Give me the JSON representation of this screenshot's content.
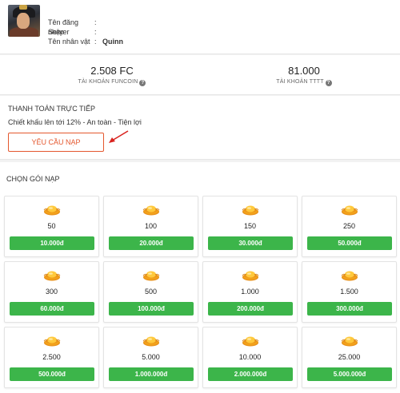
{
  "profile": {
    "login_label": "Tên đăng nhập",
    "login_sep": ":",
    "login_value": "",
    "server_label": "Server",
    "server_sep": ":",
    "server_value": "",
    "character_label": "Tên nhân vật",
    "character_sep": ":",
    "character_value": "Quinn"
  },
  "balances": {
    "funcoin_value": "2.508 FC",
    "funcoin_label": "TÀI KHOẢN FUNCOIN",
    "tttt_value": "81.000",
    "tttt_label": "TÀI KHOẢN TTTT",
    "help_glyph": "?"
  },
  "direct": {
    "title": "THANH TOÁN TRỰC TIẾP",
    "subtitle": "Chiết khấu lên tới 12% - An toàn - Tiện lợi",
    "button_label": "YÊU CẦU NẠP"
  },
  "packages": {
    "title": "CHỌN GÓI NẠP",
    "items": [
      {
        "amount": "50",
        "price": "10.000đ"
      },
      {
        "amount": "100",
        "price": "20.000đ"
      },
      {
        "amount": "150",
        "price": "30.000đ"
      },
      {
        "amount": "250",
        "price": "50.000đ"
      },
      {
        "amount": "300",
        "price": "60.000đ"
      },
      {
        "amount": "500",
        "price": "100.000đ"
      },
      {
        "amount": "1.000",
        "price": "200.000đ"
      },
      {
        "amount": "1.500",
        "price": "300.000đ"
      },
      {
        "amount": "2.500",
        "price": "500.000đ"
      },
      {
        "amount": "5.000",
        "price": "1.000.000đ"
      },
      {
        "amount": "10.000",
        "price": "2.000.000đ"
      },
      {
        "amount": "25.000",
        "price": "5.000.000đ"
      }
    ]
  },
  "colors": {
    "accent_red": "#e4572e",
    "price_green": "#3cb54a",
    "ingot_gold": "#f2a21b"
  },
  "icons": {
    "avatar": "character-portrait",
    "package": "gold-ingot-icon",
    "help": "question-circle-icon",
    "pointer": "red-arrow-icon"
  }
}
